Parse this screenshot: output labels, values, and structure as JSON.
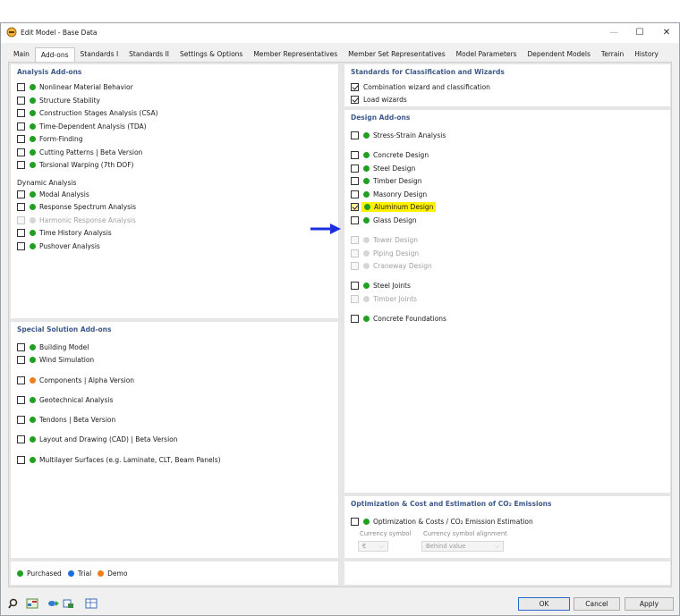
{
  "window": {
    "title": "Edit Model - Base Data"
  },
  "tabs": [
    "Main",
    "Add-ons",
    "Standards I",
    "Standards II",
    "Settings & Options",
    "Member Representatives",
    "Member Set Representatives",
    "Model Parameters",
    "Dependent Models",
    "Terrain",
    "History"
  ],
  "active_tab": "Add-ons",
  "analysis_addons": {
    "title": "Analysis Add-ons",
    "items": [
      {
        "label": "Nonlinear Material Behavior",
        "checked": false,
        "status": "green"
      },
      {
        "label": "Structure Stability",
        "checked": false,
        "status": "green"
      },
      {
        "label": "Construction Stages Analysis (CSA)",
        "checked": false,
        "status": "green"
      },
      {
        "label": "Time-Dependent Analysis (TDA)",
        "checked": false,
        "status": "green"
      },
      {
        "label": "Form-Finding",
        "checked": false,
        "status": "green"
      },
      {
        "label": "Cutting Patterns | Beta Version",
        "checked": false,
        "status": "green"
      },
      {
        "label": "Torsional Warping (7th DOF)",
        "checked": false,
        "status": "green"
      }
    ],
    "dynamic_title": "Dynamic Analysis",
    "dynamic_items": [
      {
        "label": "Modal Analysis",
        "checked": false,
        "status": "green"
      },
      {
        "label": "Response Spectrum Analysis",
        "checked": false,
        "status": "green"
      },
      {
        "label": "Harmonic Response Analysis",
        "checked": false,
        "status": "gray",
        "disabled": true
      },
      {
        "label": "Time History Analysis",
        "checked": false,
        "status": "green"
      },
      {
        "label": "Pushover Analysis",
        "checked": false,
        "status": "green"
      }
    ]
  },
  "special_addons": {
    "title": "Special Solution Add-ons",
    "items": [
      {
        "label": "Building Model",
        "checked": false,
        "status": "green"
      },
      {
        "label": "Wind Simulation",
        "checked": false,
        "status": "green"
      },
      {
        "label": "Components | Alpha Version",
        "checked": false,
        "status": "orange"
      },
      {
        "label": "Geotechnical Analysis",
        "checked": false,
        "status": "green"
      },
      {
        "label": "Tendons | Beta Version",
        "checked": false,
        "status": "green"
      },
      {
        "label": "Layout and Drawing (CAD) | Beta Version",
        "checked": false,
        "status": "green"
      },
      {
        "label": "Multilayer Surfaces (e.g. Laminate, CLT, Beam Panels)",
        "checked": false,
        "status": "green"
      }
    ]
  },
  "standards_wizards": {
    "title": "Standards for Classification and Wizards",
    "items": [
      {
        "label": "Combination wizard and classification",
        "checked": true
      },
      {
        "label": "Load wizards",
        "checked": true
      }
    ]
  },
  "design_addons": {
    "title": "Design Add-ons",
    "items": [
      {
        "label": "Stress-Strain Analysis",
        "checked": false,
        "status": "green"
      },
      {
        "label": "Concrete Design",
        "checked": false,
        "status": "green"
      },
      {
        "label": "Steel Design",
        "checked": false,
        "status": "green"
      },
      {
        "label": "Timber Design",
        "checked": false,
        "status": "green"
      },
      {
        "label": "Masonry Design",
        "checked": false,
        "status": "green"
      },
      {
        "label": "Aluminum Design",
        "checked": true,
        "status": "green",
        "highlighted": true
      },
      {
        "label": "Glass Design",
        "checked": false,
        "status": "green"
      },
      {
        "label": "Tower Design",
        "checked": false,
        "status": "gray",
        "disabled": true
      },
      {
        "label": "Piping Design",
        "checked": false,
        "status": "gray",
        "disabled": true
      },
      {
        "label": "Craneway Design",
        "checked": false,
        "status": "gray",
        "disabled": true
      },
      {
        "label": "Steel Joints",
        "checked": false,
        "status": "green"
      },
      {
        "label": "Timber Joints",
        "checked": false,
        "status": "gray",
        "disabled": true
      },
      {
        "label": "Concrete Foundations",
        "checked": false,
        "status": "green"
      }
    ]
  },
  "optimization": {
    "title": "Optimization & Cost and Estimation of CO₂ Emissions",
    "item": {
      "label": "Optimization & Costs / CO₂ Emission Estimation",
      "checked": false,
      "status": "green"
    },
    "currency_symbol_label": "Currency symbol",
    "currency_symbol_value": "€",
    "alignment_label": "Currency symbol alignment",
    "alignment_value": "Behind value"
  },
  "legend": {
    "purchased": "Purchased",
    "trial": "Trial",
    "demo": "Demo"
  },
  "colors": {
    "green": "#1fa01f",
    "blue": "#1a6fe0",
    "orange": "#ef7d1a",
    "highlight": "#fff200",
    "arrow": "#1a2fe0"
  },
  "buttons": {
    "ok": "OK",
    "cancel": "Cancel",
    "apply": "Apply"
  },
  "toolbar_icons": [
    "search-icon",
    "units-icon",
    "display-icon",
    "model-icon",
    "table-icon"
  ]
}
